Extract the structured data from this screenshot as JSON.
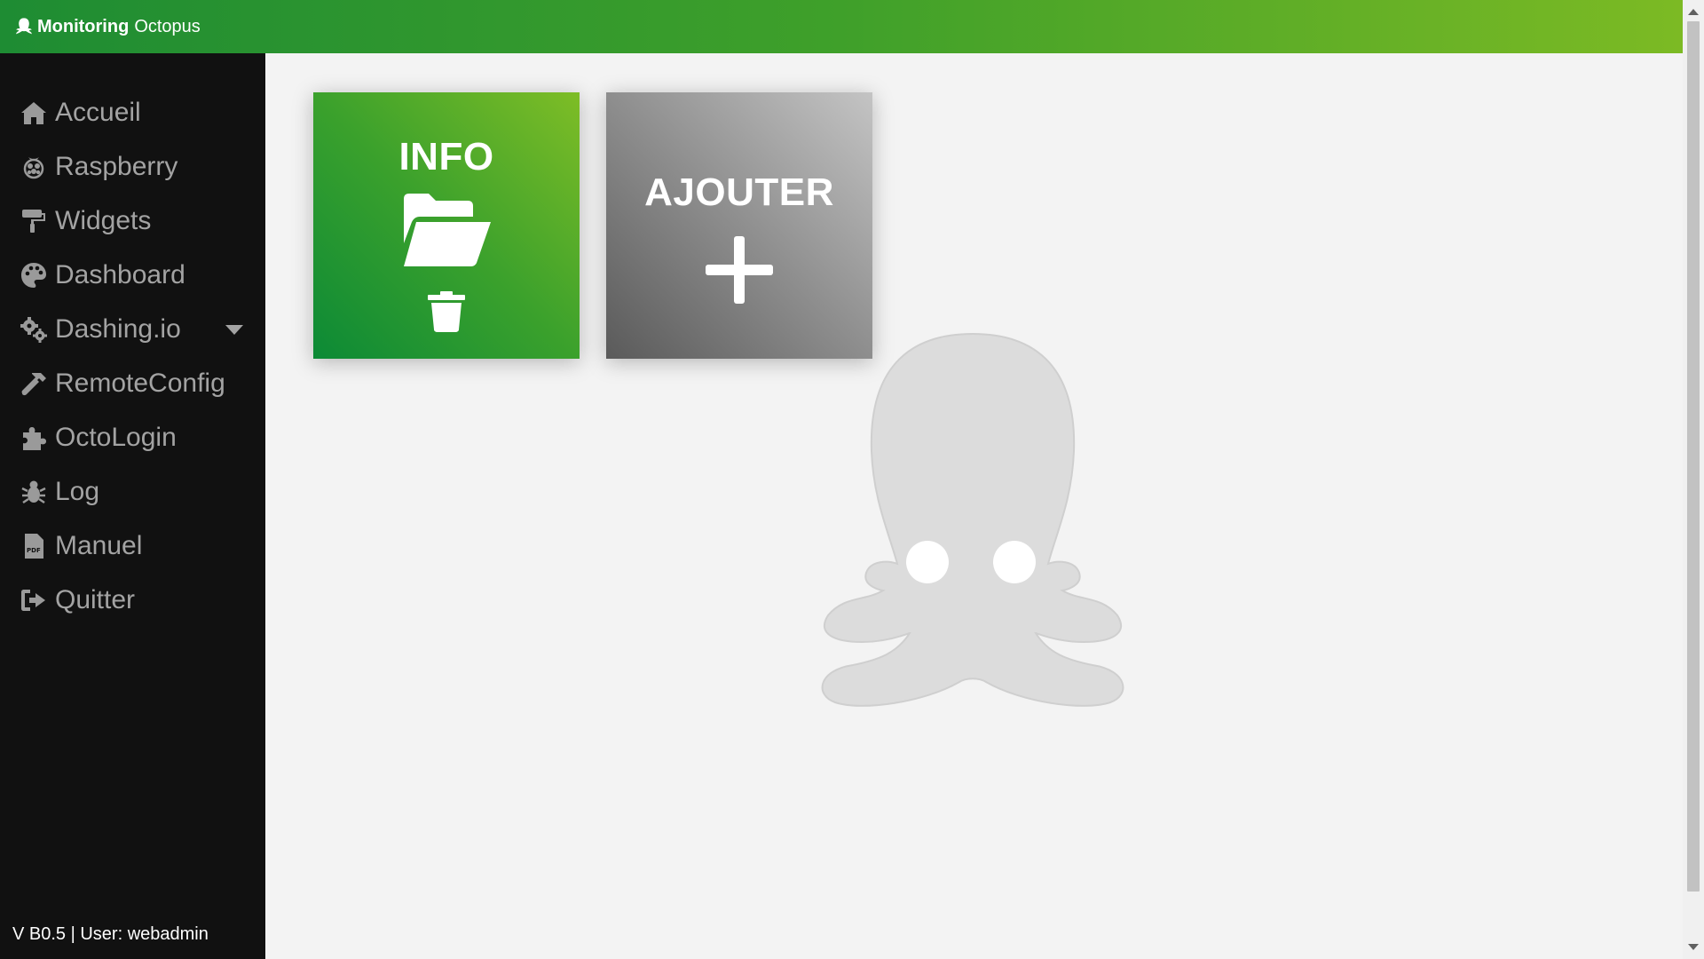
{
  "app": {
    "brand_bold": "Monitoring",
    "brand_light": "Octopus"
  },
  "sidebar": {
    "items": [
      {
        "label": "Accueil",
        "icon": "home-icon"
      },
      {
        "label": "Raspberry",
        "icon": "raspberry-icon"
      },
      {
        "label": "Widgets",
        "icon": "paint-roller-icon"
      },
      {
        "label": "Dashboard",
        "icon": "palette-icon"
      },
      {
        "label": "Dashing.io",
        "icon": "gears-icon",
        "has_dropdown": true
      },
      {
        "label": "RemoteConfig",
        "icon": "hammer-icon"
      },
      {
        "label": "OctoLogin",
        "icon": "puzzle-icon"
      },
      {
        "label": "Log",
        "icon": "bug-icon"
      },
      {
        "label": "Manuel",
        "icon": "pdf-file-icon"
      },
      {
        "label": "Quitter",
        "icon": "sign-out-icon"
      }
    ],
    "footer": "V B0.5 | User: webadmin"
  },
  "cards": {
    "info": {
      "title": "INFO",
      "icons": [
        "folder-open-icon",
        "trash-icon"
      ]
    },
    "add": {
      "title": "AJOUTER",
      "icons": [
        "plus-icon"
      ]
    }
  },
  "colors": {
    "topbar_start": "#1e8c33",
    "topbar_end": "#7cba24",
    "sidebar_bg": "#111111",
    "content_bg": "#f3f3f3",
    "octopus_watermark": "#dcdcdc"
  }
}
